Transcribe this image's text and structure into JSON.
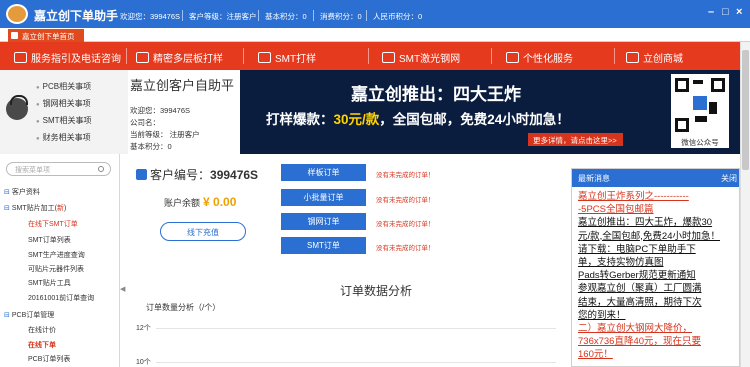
{
  "titlebar": {
    "app_title": "嘉立创下单助手",
    "welcome": "欢迎您：399476S",
    "level": "客户等级：注册客户",
    "basic_points": "基本积分：0",
    "consume_points": "消费积分：0",
    "cny_points": "人民币积分：0"
  },
  "tab": {
    "label": "嘉立创下单首页"
  },
  "nav": {
    "items": [
      "服务指引及电话咨询",
      "精密多层板打样",
      "SMT打样",
      "SMT激光钢网",
      "个性化服务",
      "立创商城"
    ]
  },
  "quick_links": [
    "PCB相关事项",
    "钢网相关事项",
    "SMT相关事项",
    "财务相关事项"
  ],
  "user": {
    "title": "嘉立创客户自助平",
    "welcome": "欢迎您：399476S",
    "company": "公司名：",
    "level": "当前等级：  注册客户",
    "points": "基本积分：0"
  },
  "banner": {
    "title": "嘉立创推出：四大王炸",
    "sub_prefix": "打样爆款：",
    "sub_highlight": "30元/款",
    "sub_suffix": "，全国包邮，免费24小时加急！",
    "more": "更多详情，请点击这里>>",
    "qr_label": "微信公众号"
  },
  "sidebar": {
    "search_placeholder": "搜索菜单项",
    "items": [
      {
        "label": "客户资料",
        "type": "root"
      },
      {
        "label": "SMT贴片加工(",
        "extra": "新",
        "end": ")",
        "type": "root"
      },
      {
        "label": "在线下SMT订单",
        "type": "child-sel"
      },
      {
        "label": "SMT订单列表",
        "type": "child"
      },
      {
        "label": "SMT生产进度查询",
        "type": "child"
      },
      {
        "label": "可贴片元器件列表",
        "type": "child"
      },
      {
        "label": "SMT贴片工具",
        "type": "child"
      },
      {
        "label": "20161001前订单查询",
        "type": "child"
      },
      {
        "label": "PCB订单管理",
        "type": "root"
      },
      {
        "label": "在线计价",
        "type": "child"
      },
      {
        "label": "在线下单",
        "type": "child-sel2"
      },
      {
        "label": "PCB订单列表",
        "type": "child"
      }
    ]
  },
  "main": {
    "customer_label": "客户编号：",
    "customer_id": "399476S",
    "balance_label": "账户余额",
    "balance": "¥ 0.00",
    "recharge": "线下充值",
    "order_buttons": [
      "样板订单",
      "小批量订单",
      "钢网订单",
      "SMT订单"
    ],
    "order_note": "没有未完成的订单！",
    "section_title": "订单数据分析",
    "chart_title": "订单数量分析（/个）"
  },
  "chart_data": {
    "type": "line",
    "title": "订单数量分析（/个）",
    "ylabel": "",
    "y_ticks": [
      "12个",
      "10个"
    ],
    "series": []
  },
  "news": {
    "header": "最新消息",
    "close": "关闭",
    "lines": [
      {
        "text": "嘉立创王炸系列之-----------",
        "style": "r"
      },
      {
        "text": "-5PCS全国包邮篇",
        "style": "r"
      },
      {
        "text": "嘉立创推出：四大王炸，爆款30",
        "style": "b"
      },
      {
        "text": "元/款,全国包邮,免费24小时加急！",
        "style": "b"
      },
      {
        "text": "请下载：电脑PC下单助手下",
        "style": "b"
      },
      {
        "text": "单，支持实物仿真图",
        "style": "b"
      },
      {
        "text": "Pads转Gerber规范更新通知",
        "style": "b"
      },
      {
        "text": "参观嘉立创（聚真）工厂圆满",
        "style": "b"
      },
      {
        "text": "结束，大量高清照，期待下次",
        "style": "b"
      },
      {
        "text": "您的到来！",
        "style": "b"
      },
      {
        "text": "二）嘉立创大钢网大降价，",
        "style": "r"
      },
      {
        "text": "736x736直降40元，现在只要",
        "style": "r"
      },
      {
        "text": "160元！",
        "style": "r"
      }
    ]
  },
  "colors": {
    "accent": "#2a6fd1",
    "nav_red": "#e63a1f",
    "alert_red": "#d6341c",
    "balance": "#f0a000"
  }
}
